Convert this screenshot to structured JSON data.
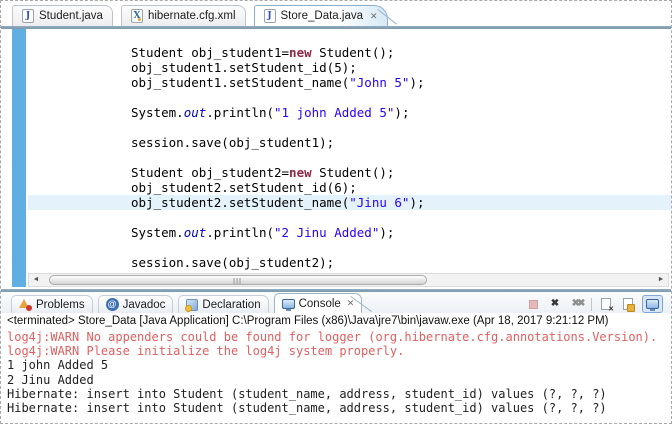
{
  "colors": {
    "accent_line": "#7b97aa",
    "editor_strip": "#61aee3",
    "line_highlight": "#e3f2fb",
    "keyword": "#8c2742",
    "string": "#2a00ff",
    "static_field": "#0000c0",
    "console_error": "#e05f5f",
    "console_text": "#1f1f1f"
  },
  "glyphs": {
    "java_letter": "J",
    "xml_letter": "X",
    "close": "✕",
    "at": "@",
    "x_mark": "✖",
    "left_arrow": "◄",
    "right_arrow": "►"
  },
  "editor_tabs": [
    {
      "label": "Student.java",
      "icon": "java-file",
      "active": false,
      "closable": false
    },
    {
      "label": "hibernate.cfg.xml",
      "icon": "xml-file",
      "active": false,
      "closable": false
    },
    {
      "label": "Store_Data.java",
      "icon": "java-file",
      "active": true,
      "closable": true
    }
  ],
  "editor": {
    "highlight_line_index": 10,
    "lines": [
      [
        [
          "d",
          "Student obj_student1="
        ],
        [
          "k",
          "new"
        ],
        [
          "d",
          " Student();"
        ]
      ],
      [
        [
          "d",
          "obj_student1.setStudent_id(5);"
        ]
      ],
      [
        [
          "d",
          "obj_student1.setStudent_name("
        ],
        [
          "s",
          "\"John 5\""
        ],
        [
          "d",
          ");"
        ]
      ],
      [],
      [
        [
          "d",
          "System."
        ],
        [
          "f",
          "out"
        ],
        [
          "d",
          ".println("
        ],
        [
          "s",
          "\"1 john Added 5\""
        ],
        [
          "d",
          ");"
        ]
      ],
      [],
      [
        [
          "d",
          "session.save(obj_student1);"
        ]
      ],
      [],
      [
        [
          "d",
          "Student obj_student2="
        ],
        [
          "k",
          "new"
        ],
        [
          "d",
          " Student();"
        ]
      ],
      [
        [
          "d",
          "obj_student2.setStudent_id(6);"
        ]
      ],
      [
        [
          "d",
          "obj_student2.setStudent_name("
        ],
        [
          "s",
          "\"Jinu 6\""
        ],
        [
          "d",
          ");"
        ]
      ],
      [],
      [
        [
          "d",
          "System."
        ],
        [
          "f",
          "out"
        ],
        [
          "d",
          ".println("
        ],
        [
          "s",
          "\"2 Jinu Added\""
        ],
        [
          "d",
          ");"
        ]
      ],
      [],
      [
        [
          "d",
          "session.save(obj_student2);"
        ]
      ]
    ]
  },
  "bottom_tabs": [
    {
      "label": "Problems",
      "icon": "problems",
      "active": false,
      "closable": false
    },
    {
      "label": "Javadoc",
      "icon": "javadoc",
      "active": false,
      "closable": false
    },
    {
      "label": "Declaration",
      "icon": "declaration",
      "active": false,
      "closable": false
    },
    {
      "label": "Console",
      "icon": "console",
      "active": true,
      "closable": true
    }
  ],
  "console_toolbar": {
    "icons": [
      {
        "name": "terminate-icon"
      },
      {
        "name": "remove-launch-icon"
      },
      {
        "name": "remove-all-terminated-icon"
      },
      {
        "name": "separator"
      },
      {
        "name": "clear-console-icon"
      },
      {
        "name": "scroll-lock-icon"
      },
      {
        "name": "pin-console-icon",
        "selected": true
      }
    ]
  },
  "console": {
    "header": "<terminated> Store_Data [Java Application] C:\\Program Files (x86)\\Java\\jre7\\bin\\javaw.exe (Apr 18, 2017 9:21:12 PM)",
    "lines": [
      {
        "level": "error",
        "text": "log4j:WARN No appenders could be found for logger (org.hibernate.cfg.annotations.Version)."
      },
      {
        "level": "error",
        "text": "log4j:WARN Please initialize the log4j system properly."
      },
      {
        "level": "info",
        "text": "1 john Added 5"
      },
      {
        "level": "info",
        "text": "2 Jinu Added"
      },
      {
        "level": "info",
        "text": "Hibernate: insert into Student (student_name, address, student_id) values (?, ?, ?)"
      },
      {
        "level": "info",
        "text": "Hibernate: insert into Student (student_name, address, student_id) values (?, ?, ?)"
      }
    ]
  }
}
